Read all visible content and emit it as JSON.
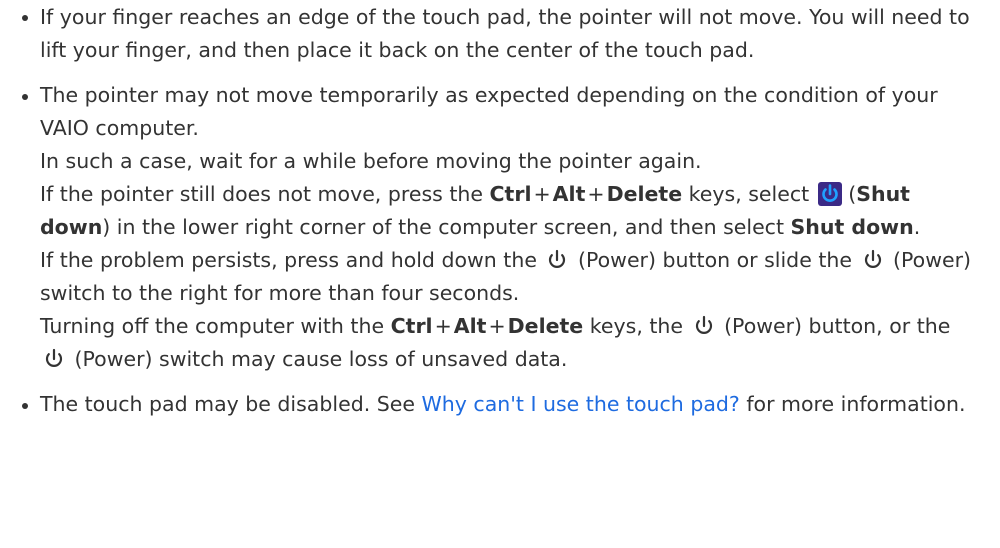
{
  "items": {
    "edge": {
      "text": "If your finger reaches an edge of the touch pad, the pointer will not move. You will need to lift your finger, and then place it back on the center of the touch pad."
    },
    "temporary": {
      "line1": "The pointer may not move temporarily as expected depending on the condition of your VAIO computer.",
      "line2": "In such a case, wait for a while before moving the pointer again.",
      "line3a": "If the pointer still does not move, press the",
      "key_ctrl": "Ctrl",
      "plus": "+",
      "key_alt": "Alt",
      "key_delete": "Delete",
      "line3b": "keys, select",
      "paren_open": "(",
      "shut_down": "Shut down",
      "line3c": ") in the lower right corner of the computer screen, and then select",
      "period": ".",
      "line4a": "If the problem persists, press and hold down the",
      "line4b": "(Power) button or slide the",
      "line4c": "(Power) switch to the right for more than four seconds.",
      "line5a": "Turning off the computer with the",
      "line5b": "keys, the",
      "line5c": "(Power) button, or the",
      "line5d": "(Power) switch may cause loss of unsaved data."
    },
    "disabled": {
      "before": "The touch pad may be disabled. See",
      "link": "Why can't I use the touch pad?",
      "after": "for more information."
    }
  },
  "colors": {
    "text": "#333333",
    "link": "#1e6be0",
    "shutdown_icon_bg": "#3b2a86"
  },
  "icons": {
    "shutdown": "shutdown-icon",
    "power": "power-icon"
  }
}
